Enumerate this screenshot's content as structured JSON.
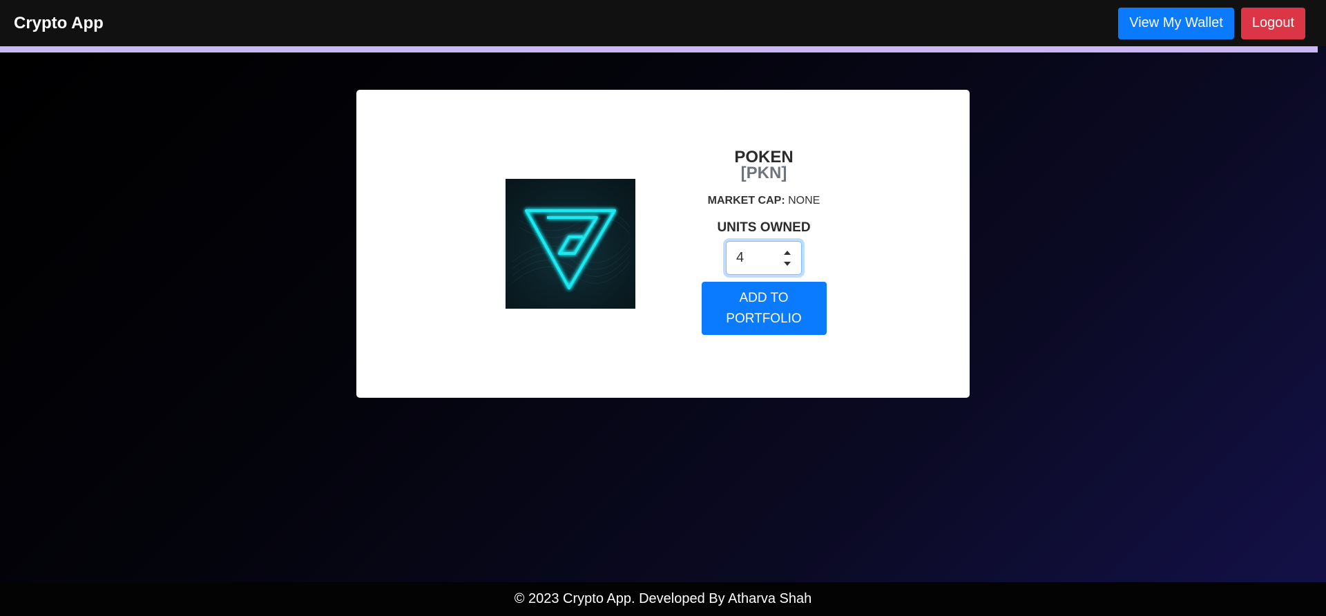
{
  "navbar": {
    "brand": "Crypto App",
    "wallet_label": "View My Wallet",
    "logout_label": "Logout"
  },
  "coin": {
    "name": "POKEN",
    "symbol": "[PKN]",
    "market_cap_label": "MARKET CAP:",
    "market_cap_value": "NONE",
    "units_label": "UNITS OWNED",
    "units_value": "4",
    "add_label": "ADD TO PORTFOLIO",
    "image_icon": "poken-logo-icon"
  },
  "footer": {
    "text": "© 2023 Crypto App. Developed By Atharva Shah"
  },
  "colors": {
    "primary": "#0a7bff",
    "danger": "#dc3545",
    "accent_bar": "#c9b8f5",
    "logo_glow": "#1ee8f0"
  }
}
